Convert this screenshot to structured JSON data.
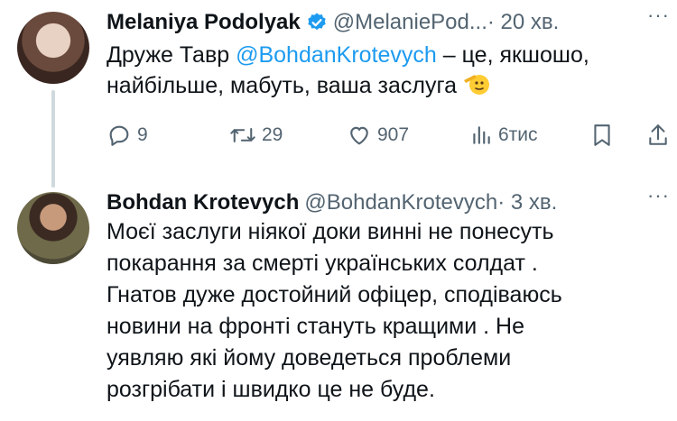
{
  "tweets": [
    {
      "author": "Melaniya Podolyak",
      "verified": true,
      "handle": "@MelaniePod...",
      "time": "· 20 хв.",
      "text_before": "Друже Тавр ",
      "mention": "@BohdanKrotevych",
      "text_after": " – це, якшошо, найбільше, мабуть, ваша заслуга",
      "emoji": "saluting-face-emoji",
      "actions": {
        "replies": "9",
        "retweets": "29",
        "likes": "907",
        "views": "6тис"
      }
    },
    {
      "author": "Bohdan Krotevych",
      "handle": "@BohdanKrotevych",
      "time": "· 3 хв.",
      "lines": [
        "Моєї заслуги ніякої доки винні не понесуть",
        "покарання за смерті  українських солдат .",
        "Гнатов дуже достойний офіцер, сподіваюсь",
        "новини на фронті стануть кращими . Не",
        "уявляю які йому доведеться проблеми",
        "розгрібати і швидко це не буде."
      ]
    }
  ],
  "more_label": "···",
  "colors": {
    "text": "#0f1419",
    "secondary": "#536471",
    "accent": "#1d9bf0",
    "thread_line": "#cfd9de"
  }
}
